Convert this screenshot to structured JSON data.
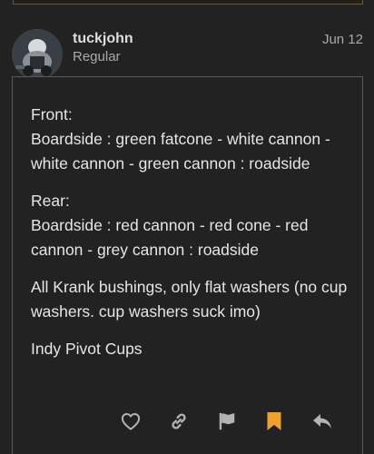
{
  "post": {
    "username": "tuckjohn",
    "user_title": "Regular",
    "date": "Jun 12",
    "paragraphs": [
      {
        "lines": [
          "Front:",
          "Boardside : green fatcone - white cannon - white cannon - green cannon : roadside"
        ]
      },
      {
        "lines": [
          "Rear:",
          "Boardside : red cannon - red cone - red cannon - grey cannon : roadside"
        ]
      },
      {
        "lines": [
          "All Krank bushings, only flat washers (no cup washers. cup washers suck imo)"
        ]
      },
      {
        "lines": [
          "Indy Pivot Cups"
        ]
      }
    ]
  },
  "actions": [
    {
      "name": "like-button",
      "icon": "heart-icon",
      "color": "#b3b3b3"
    },
    {
      "name": "copy-link-button",
      "icon": "link-icon",
      "color": "#b3b3b3"
    },
    {
      "name": "flag-button",
      "icon": "flag-icon",
      "color": "#b3b3b3"
    },
    {
      "name": "bookmark-button",
      "icon": "bookmark-icon",
      "color": "#f0a030"
    },
    {
      "name": "reply-button",
      "icon": "reply-icon",
      "color": "#b3b3b3"
    }
  ],
  "colors": {
    "background": "#222222",
    "text": "#e6e6e6",
    "muted": "#a9a9a9",
    "accent": "#f0a030",
    "border": "#5a5a5a"
  }
}
